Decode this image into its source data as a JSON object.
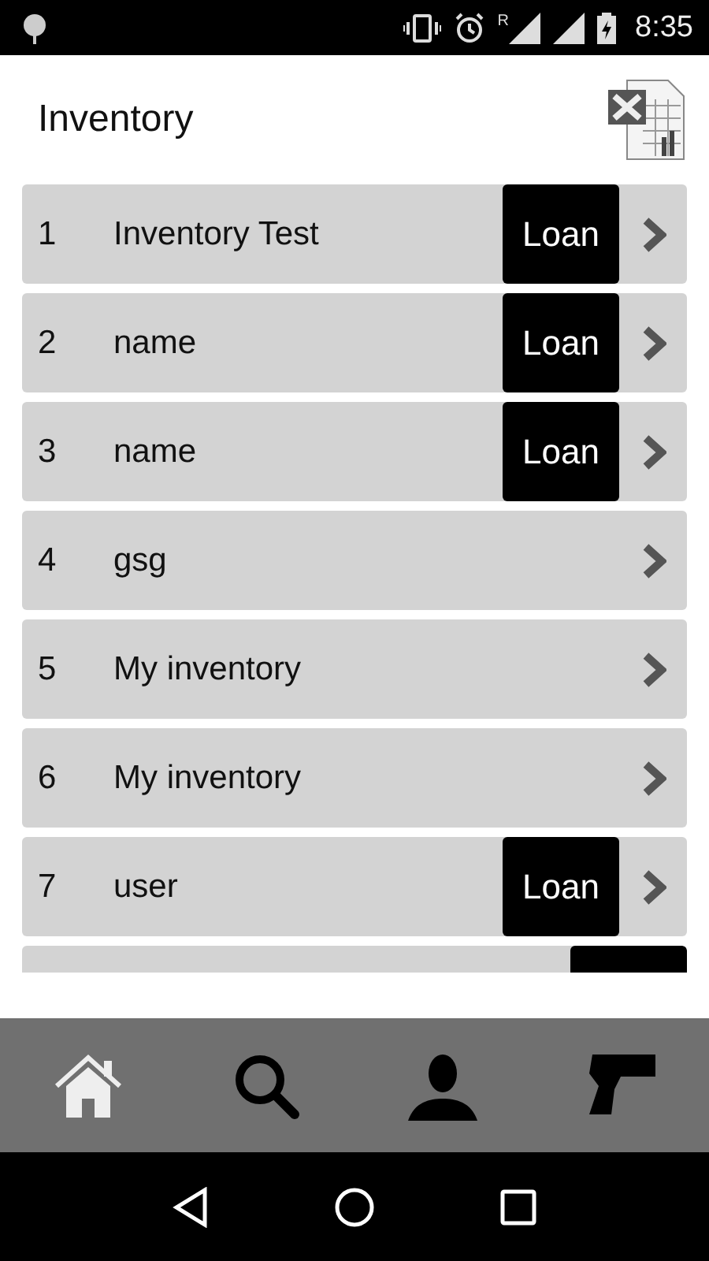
{
  "status_bar": {
    "roaming": "R",
    "time": "8:35"
  },
  "header": {
    "title": "Inventory"
  },
  "inventories": [
    {
      "number": "1",
      "name": "Inventory Test",
      "loan": true,
      "loan_label": "Loan"
    },
    {
      "number": "2",
      "name": "name",
      "loan": true,
      "loan_label": "Loan"
    },
    {
      "number": "3",
      "name": "name",
      "loan": true,
      "loan_label": "Loan"
    },
    {
      "number": "4",
      "name": "gsg",
      "loan": false
    },
    {
      "number": "5",
      "name": "My inventory",
      "loan": false
    },
    {
      "number": "6",
      "name": "My inventory",
      "loan": false
    },
    {
      "number": "7",
      "name": "user",
      "loan": true,
      "loan_label": "Loan"
    },
    {
      "loan": true
    }
  ],
  "bottom_nav": [
    {
      "kind": "home",
      "selected": true
    },
    {
      "kind": "search",
      "selected": false
    },
    {
      "kind": "profile",
      "selected": false
    },
    {
      "kind": "scanner",
      "selected": false
    }
  ]
}
